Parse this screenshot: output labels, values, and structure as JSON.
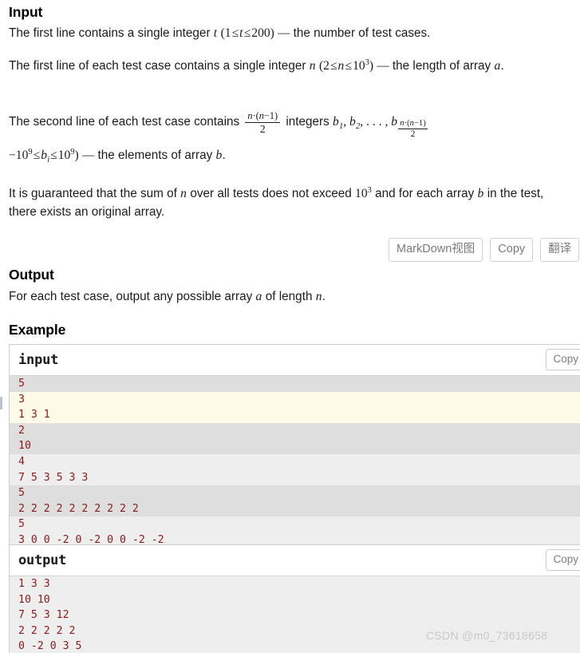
{
  "sections": {
    "input_title": "Input",
    "output_title": "Output",
    "example_title": "Example"
  },
  "input_paragraphs": {
    "p1": {
      "lead": "The first line contains a single integer ",
      "var_t": "t",
      "paren_open": "(",
      "low": "1",
      "le1": "≤",
      "var_t2": "t",
      "le2": "≤",
      "high": "200",
      "paren_close": ")",
      "emdash": "—",
      "tail": "the number of test cases."
    },
    "p2": {
      "lead": "The first line of each test case contains a single integer ",
      "var_n": "n",
      "paren_open": "(",
      "low": "2",
      "le1": "≤",
      "var_n2": "n",
      "le2": "≤",
      "base": "10",
      "exp": "3",
      "paren_close": ")",
      "emdash": "—",
      "tail": "the length of array ",
      "var_a": "a",
      "period": "."
    },
    "p3": {
      "lead": "The second line of each test case contains ",
      "frac_num_n": "n",
      "frac_num_dot": "·(",
      "frac_num_n2": "n",
      "frac_num_rest": "−1)",
      "frac_den": "2",
      "mid": " integers ",
      "b1": "b",
      "b1sub": "1",
      "comma1": ", ",
      "b2": "b",
      "b2sub": "2",
      "comma2": ", . . . , ",
      "b3": "b",
      "sub_frac_num_n": "n",
      "sub_frac_num_dot": "·(",
      "sub_frac_num_n2": "n",
      "sub_frac_num_rest": "−1)",
      "sub_frac_den": "2",
      "line2_neg": "−",
      "line2_base1": "10",
      "line2_exp1": "9",
      "line2_le1": "≤",
      "line2_b": "b",
      "line2_bsub": "i",
      "line2_le2": "≤",
      "line2_base2": "10",
      "line2_exp2": "9",
      "line2_paren": ")",
      "line2_emdash": "—",
      "line2_tail": "the elements of array ",
      "line2_varb": "b",
      "line2_period": "."
    },
    "p4": {
      "lead": "It is guaranteed that the sum of ",
      "var_n": "n",
      "mid": " over all tests does not exceed ",
      "base": "10",
      "exp": "3",
      "mid2": " and for each array ",
      "var_b": "b",
      "tail": " in the test, there exists an original array."
    }
  },
  "output_paragraph": {
    "lead": "For each test case, output any possible array ",
    "var_a": "a",
    "mid": " of length ",
    "var_n": "n",
    "period": "."
  },
  "toolbar": {
    "markdown_label": "MarkDown视图",
    "copy_label": "Copy",
    "translate_label": "翻译"
  },
  "example": {
    "input_block": {
      "title": "input",
      "copy_label": "Copy",
      "lines": [
        {
          "text": "5",
          "bg": "bg-grey"
        },
        {
          "text": "3",
          "bg": "bg-cream"
        },
        {
          "text": "1 3 1",
          "bg": "bg-cream"
        },
        {
          "text": "2",
          "bg": "bg-grey"
        },
        {
          "text": "10",
          "bg": "bg-grey"
        },
        {
          "text": "4",
          "bg": "bg-light"
        },
        {
          "text": "7 5 3 5 3 3",
          "bg": "bg-light"
        },
        {
          "text": "5",
          "bg": "bg-grey"
        },
        {
          "text": "2 2 2 2 2 2 2 2 2 2",
          "bg": "bg-grey"
        },
        {
          "text": "5",
          "bg": "bg-light"
        },
        {
          "text": "3 0 0 -2 0 -2 0 0 -2 -2",
          "bg": "bg-light"
        }
      ]
    },
    "output_block": {
      "title": "output",
      "copy_label": "Copy",
      "lines": [
        {
          "text": "1 3 3",
          "bg": "bg-light"
        },
        {
          "text": "10 10",
          "bg": "bg-light"
        },
        {
          "text": "7 5 3 12",
          "bg": "bg-light"
        },
        {
          "text": "2 2 2 2 2",
          "bg": "bg-light"
        },
        {
          "text": "0 -2 0 3 5",
          "bg": "bg-light"
        }
      ]
    }
  },
  "watermark": "CSDN @m0_73618658"
}
